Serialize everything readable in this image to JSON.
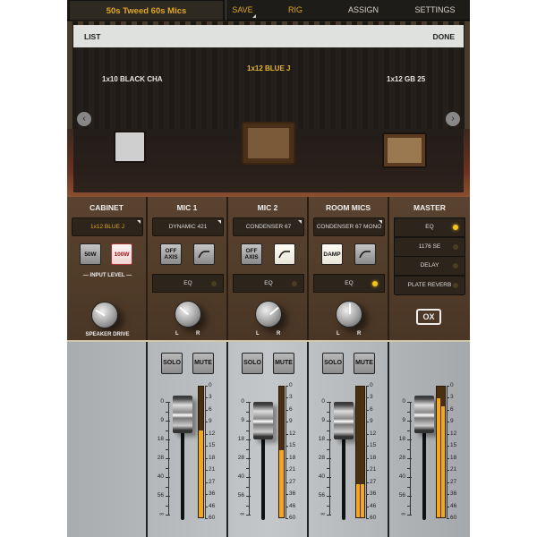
{
  "topbar": {
    "preset": "50s Tweed 60s Mics",
    "save": "SAVE",
    "tabs": [
      "RIG",
      "ASSIGN",
      "SETTINGS"
    ],
    "active_tab": "RIG"
  },
  "browser": {
    "list": "LIST",
    "done": "DONE",
    "cabinets": [
      "1x10 BLACK CHA",
      "1x12 BLUE J",
      "1x12 GB 25"
    ],
    "selected": "1x12 BLUE J"
  },
  "cabinet": {
    "title": "CABINET",
    "model": "1x12 BLUE J",
    "power": [
      "50W",
      "100W"
    ],
    "power_selected": "100W",
    "input_level": "INPUT LEVEL",
    "knob_label": "SPEAKER DRIVE",
    "knob_angle_deg": -60
  },
  "channels": [
    {
      "title": "MIC 1",
      "model": "DYNAMIC 421",
      "btn1": "OFF AXIS",
      "btn1_on": false,
      "hp_on": false,
      "eq": "EQ",
      "eq_on": false,
      "pan_angle_deg": -50,
      "solo": "SOLO",
      "mute": "MUTE",
      "fader_db": 6,
      "meter_db": [
        -11
      ]
    },
    {
      "title": "MIC 2",
      "model": "CONDENSER 67",
      "btn1": "OFF AXIS",
      "btn1_on": false,
      "hp_on": true,
      "eq": "EQ",
      "eq_on": false,
      "pan_angle_deg": 50,
      "solo": "SOLO",
      "mute": "MUTE",
      "fader_db": 9,
      "meter_db": [
        -16
      ]
    },
    {
      "title": "ROOM MICS",
      "model": "CONDENSER 67 MONO",
      "btn1": "DAMP",
      "btn1_on": true,
      "hp_on": false,
      "eq": "EQ",
      "eq_on": true,
      "pan_angle_deg": 0,
      "solo": "SOLO",
      "mute": "MUTE",
      "fader_db": 9,
      "meter_db": [
        -29,
        -29
      ]
    }
  ],
  "master": {
    "title": "MASTER",
    "effects": [
      {
        "name": "EQ",
        "on": true
      },
      {
        "name": "1176 SE",
        "on": false
      },
      {
        "name": "DELAY",
        "on": false
      },
      {
        "name": "PLATE REVERB",
        "on": false
      }
    ],
    "logo": "OX",
    "fader_db": 6,
    "meter_db": [
      -3,
      -5
    ]
  },
  "pan_labels": [
    "L",
    "R"
  ],
  "fader_scale": [
    "0",
    "9",
    "18",
    "28",
    "40",
    "56",
    "∞"
  ],
  "meter_scale": [
    "0",
    "3",
    "6",
    "9",
    "12",
    "15",
    "18",
    "21",
    "27",
    "36",
    "46",
    "60"
  ],
  "colors": {
    "accent": "#e0a820",
    "led_on": "#f4c41c",
    "meter": "#f2a81c"
  }
}
